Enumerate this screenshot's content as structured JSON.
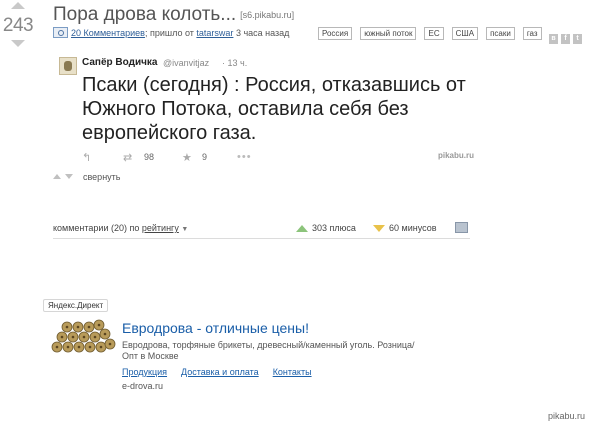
{
  "post": {
    "rating": "243",
    "title": "Пора дрова колоть...",
    "domain": "[s6.pikabu.ru]",
    "comments_link": "20 Комментариев",
    "posted_prefix": "; пришло от",
    "author": "tatarswar",
    "posted_time": "3 часа назад",
    "tags": [
      "Россия",
      "южный поток",
      "ЕС",
      "США",
      "псаки",
      "газ"
    ],
    "share_icons": [
      "vk-icon",
      "facebook-icon",
      "twitter-icon"
    ]
  },
  "tweet": {
    "name": "Сапёр Водичка",
    "handle": "@ivanvitjaz",
    "time": "· 13 ч.",
    "text": "Псаки (сегодня) : Россия, отказавшись от Южного Потока, оставила себя без европейского газа.",
    "retweets": "98",
    "favorites": "9",
    "watermark": "pikabu.ru"
  },
  "collapse_label": "свернуть",
  "comments_bar": {
    "prefix": "комментарии (20) по",
    "sort_label": "рейтингу",
    "pluses": "303 плюса",
    "minuses": "60 минусов"
  },
  "ad": {
    "label": "Яндекс.Директ",
    "title": "Евродрова - отличные цены!",
    "description": "Евродрова, торфяные брикеты, древесный/каменный уголь. Розница/Опт в Москве",
    "links": [
      "Продукция",
      "Доставка и оплата",
      "Контакты"
    ],
    "domain": "e-drova.ru"
  },
  "watermark": "pikabu.ru"
}
